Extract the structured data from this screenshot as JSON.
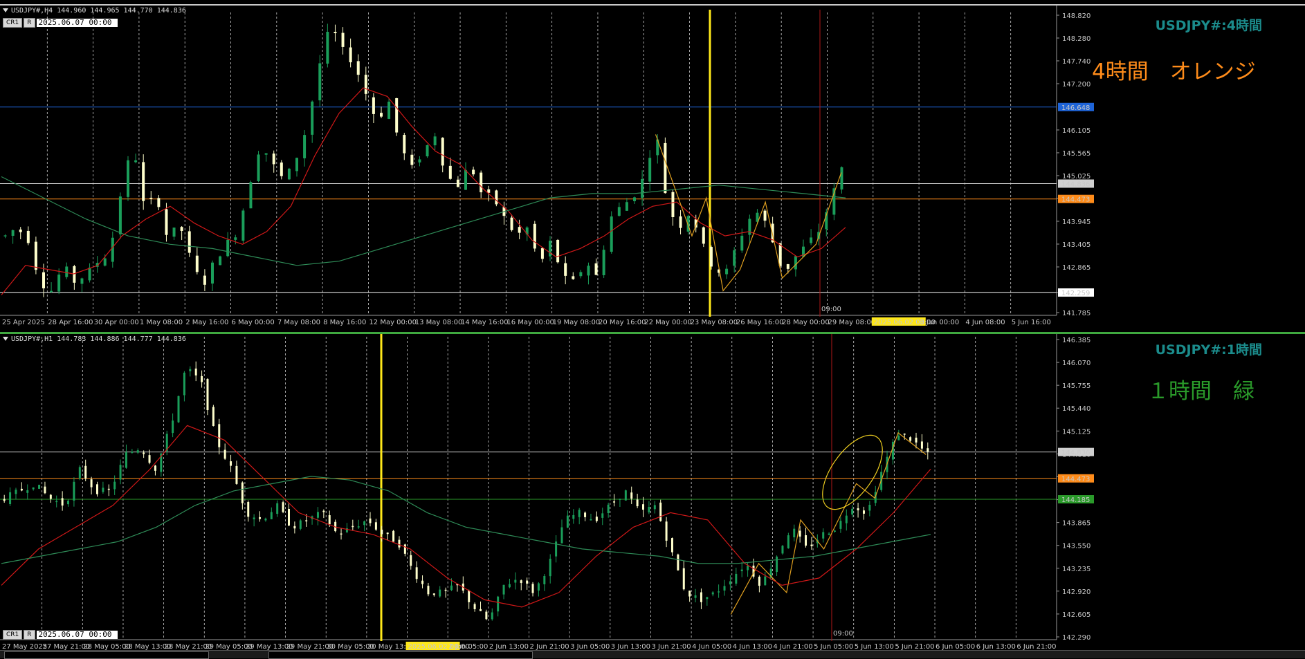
{
  "colors": {
    "bg": "#000000",
    "bull": "#1a9e5a",
    "bear": "#ffffcc",
    "ma_fast": "#d01818",
    "ma_slow": "#2e8b57",
    "zigzag": "#e0a020",
    "vline": "#ffe81a",
    "now_line": "#b01818",
    "orange_line": "#ff8c1a",
    "blue_line": "#1e64d8",
    "green_line": "#2a9a2a",
    "white_line": "#ffffff",
    "title_color": "#1b8c8c",
    "note_orange": "#ff8c1a",
    "note_green": "#2a9a2a"
  },
  "top": {
    "header": "USDJPY#,H4  144.960 144.965 144.770 144.836",
    "toolbar": {
      "cr1": "CR1",
      "r": "R",
      "date": "2025.06.07 00:00"
    },
    "title": "USDJPY#:4時間",
    "note": "4時間　オレンジ",
    "now_label": "09:00",
    "highlight_time": "2025.06.02 00:00",
    "price_labels": [
      {
        "value": 146.648,
        "text": "146.648",
        "bg": "#1e64d8",
        "color": "#ffffff"
      },
      {
        "value": 144.836,
        "text": "144.836",
        "bg": "#d0d0d0",
        "color": "#000000"
      },
      {
        "value": 144.473,
        "text": "144.473",
        "bg": "#ff8c1a",
        "color": "#000000"
      },
      {
        "value": 142.259,
        "text": "142.259",
        "bg": "#ffffff",
        "color": "#000000"
      }
    ]
  },
  "bottom": {
    "header": "USDJPY#,H1  144.783 144.886 144.777 144.836",
    "toolbar": {
      "cr1": "CR1",
      "r": "R",
      "date": "2025.06.07 00:00"
    },
    "title": "USDJPY#:1時間",
    "note": "１時間　緑",
    "now_label": "09:00",
    "highlight_time": "2025.06.02 00:00",
    "price_labels": [
      {
        "value": 144.836,
        "text": "144.836",
        "bg": "#d0d0d0",
        "color": "#000000"
      },
      {
        "value": 144.473,
        "text": "144.473",
        "bg": "#ff8c1a",
        "color": "#000000"
      },
      {
        "value": 144.185,
        "text": "144.185",
        "bg": "#2a9a2a",
        "color": "#000000"
      }
    ]
  },
  "chart_data": [
    {
      "type": "candlestick",
      "symbol": "USDJPY#",
      "timeframe": "H4",
      "ylim": [
        141.785,
        148.82
      ],
      "yticks": [
        148.82,
        148.28,
        147.74,
        147.2,
        146.105,
        145.565,
        145.025,
        144.485,
        143.945,
        143.405,
        142.865,
        142.259,
        141.785
      ],
      "ytick_labels": [
        "148.820",
        "148.280",
        "147.740",
        "147.200",
        "146.105",
        "145.565",
        "145.025",
        "144.485",
        "143.945",
        "143.405",
        "142.865",
        "142.259",
        "141.785"
      ],
      "xticks": [
        "25 Apr 2025",
        "28 Apr 16:00",
        "30 Apr 00:00",
        "1 May 08:00",
        "2 May 16:00",
        "6 May 00:00",
        "7 May 08:00",
        "8 May 16:00",
        "12 May 00:00",
        "13 May 08:00",
        "14 May 16:00",
        "16 May 00:00",
        "19 May 08:00",
        "20 May 16:00",
        "22 May 00:00",
        "23 May 08:00",
        "26 May 16:00",
        "28 May 00:00",
        "29 May 08:00",
        "2025.06.02 00:00",
        "3 Jun 00:00",
        "4 Jun 08:00",
        "5 Jun 16:00"
      ],
      "hlines": [
        146.648,
        144.473,
        142.259
      ],
      "price_path": [
        143.6,
        143.8,
        143.5,
        142.5,
        142.3,
        142.9,
        142.5,
        142.7,
        143.0,
        143.2,
        144.7,
        145.8,
        144.2,
        144.6,
        143.5,
        143.9,
        143.0,
        142.4,
        143.0,
        143.4,
        143.7,
        144.8,
        145.8,
        145.3,
        144.9,
        145.4,
        146.2,
        147.6,
        148.6,
        148.0,
        147.7,
        147.0,
        146.3,
        146.8,
        145.7,
        145.2,
        145.6,
        146.0,
        145.0,
        144.8,
        145.3,
        144.6,
        144.5,
        144.0,
        143.6,
        143.8,
        142.9,
        143.5,
        142.6,
        142.5,
        143.0,
        142.6,
        144.0,
        144.3,
        144.5,
        145.0,
        146.1,
        144.3,
        143.8,
        144.2,
        143.4,
        142.8,
        142.7,
        143.4,
        144.0,
        144.2,
        143.5,
        142.7,
        143.1,
        143.4,
        143.7,
        144.4,
        145.2
      ],
      "ma_fast": [
        142.2,
        142.9,
        142.8,
        142.7,
        142.9,
        143.6,
        144.0,
        144.3,
        143.9,
        143.6,
        143.4,
        143.7,
        144.3,
        145.5,
        146.5,
        147.1,
        146.9,
        146.2,
        145.6,
        145.3,
        144.7,
        144.2,
        143.5,
        143.1,
        143.3,
        143.6,
        144.0,
        144.3,
        144.4,
        143.9,
        143.6,
        143.7,
        143.5,
        143.1,
        143.3,
        143.8
      ],
      "ma_slow": [
        145.0,
        144.5,
        144.0,
        143.6,
        143.4,
        143.3,
        143.1,
        142.9,
        143.0,
        143.3,
        143.6,
        143.9,
        144.2,
        144.5,
        144.6,
        144.6,
        144.7,
        144.8,
        144.7,
        144.6,
        144.5
      ]
    },
    {
      "type": "candlestick",
      "symbol": "USDJPY#",
      "timeframe": "H1",
      "ylim": [
        142.29,
        146.385
      ],
      "yticks": [
        146.385,
        146.07,
        145.755,
        145.44,
        145.125,
        144.81,
        144.495,
        144.18,
        143.865,
        143.55,
        143.235,
        142.92,
        142.605,
        142.29
      ],
      "ytick_labels": [
        "146.385",
        "146.070",
        "145.755",
        "145.440",
        "145.125",
        "144.810",
        "144.495",
        "144.180",
        "143.865",
        "143.550",
        "143.235",
        "142.920",
        "142.605",
        "142.290"
      ],
      "xticks": [
        "27 May 2025",
        "27 May 21:00",
        "28 May 05:00",
        "28 May 13:00",
        "28 May 21:00",
        "29 May 05:00",
        "29 May 13:00",
        "29 May 21:00",
        "30 May 05:00",
        "30 May 13:00",
        "2025.06.02 00:00",
        "2 Jun 05:00",
        "2 Jun 13:00",
        "2 Jun 21:00",
        "3 Jun 05:00",
        "3 Jun 13:00",
        "3 Jun 21:00",
        "4 Jun 05:00",
        "4 Jun 13:00",
        "4 Jun 21:00",
        "5 Jun 05:00",
        "5 Jun 13:00",
        "5 Jun 21:00",
        "6 Jun 05:00",
        "6 Jun 13:00",
        "6 Jun 21:00"
      ],
      "hlines": [
        144.473,
        144.185
      ],
      "price_path": [
        144.2,
        144.3,
        144.4,
        144.2,
        144.1,
        144.6,
        144.3,
        144.3,
        144.8,
        144.9,
        144.6,
        145.2,
        146.0,
        145.8,
        145.0,
        144.6,
        144.0,
        143.9,
        144.1,
        143.8,
        143.9,
        144.0,
        143.7,
        143.8,
        143.9,
        143.7,
        143.6,
        143.2,
        142.9,
        142.9,
        143.0,
        142.7,
        142.5,
        143.0,
        143.1,
        142.9,
        143.3,
        143.9,
        144.0,
        143.9,
        144.1,
        144.3,
        144.0,
        144.1,
        143.5,
        142.9,
        142.8,
        142.9,
        143.1,
        143.3,
        143.0,
        143.4,
        143.8,
        143.5,
        143.7,
        143.8,
        144.1,
        144.0,
        144.6,
        145.1,
        145.0,
        144.8
      ]
    }
  ]
}
